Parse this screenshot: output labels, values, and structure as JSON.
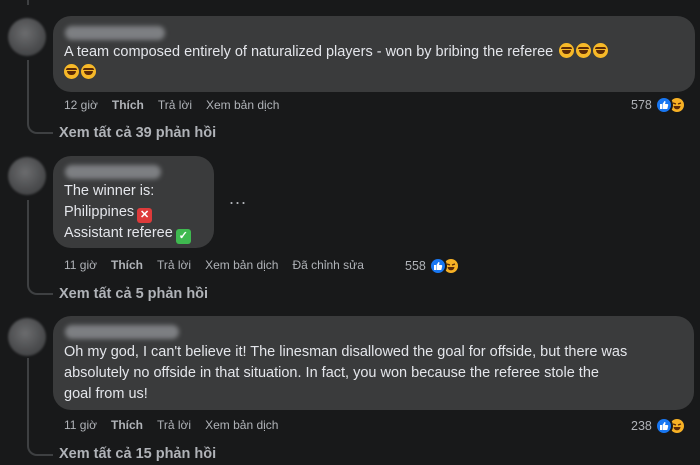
{
  "comments": [
    {
      "text_line1": "A team composed entirely of naturalized players - won by bribing the referee",
      "time": "12 giờ",
      "like_label": "Thích",
      "reply_label": "Trả lời",
      "translate_label": "Xem bản dịch",
      "reaction_count": "578",
      "view_replies": "Xem tất cả 39 phản hồi"
    },
    {
      "text_line1": "The winner is:",
      "text_line2": "Philippines",
      "text_line3": "Assistant referee",
      "time": "11 giờ",
      "like_label": "Thích",
      "reply_label": "Trả lời",
      "translate_label": "Xem bản dịch",
      "edited_label": "Đã chỉnh sửa",
      "reaction_count": "558",
      "view_replies": "Xem tất cả 5 phản hồi",
      "more_options": "..."
    },
    {
      "text_line1": "Oh my god, I can't believe it! The linesman disallowed the goal for offside, but there was",
      "text_line2": "absolutely no offside in that situation. In fact, you won because the referee stole the",
      "text_line3": "goal from us!",
      "time": "11 giờ",
      "like_label": "Thích",
      "reply_label": "Trả lời",
      "translate_label": "Xem bản dịch",
      "reaction_count": "238",
      "view_replies": "Xem tất cả 15 phản hồi"
    }
  ],
  "icons": {
    "like": "like-reaction-icon",
    "haha": "haha-reaction-icon",
    "laugh_emoji": "rolling-laughing-emoji",
    "cross": "cross-mark-emoji",
    "check": "check-mark-emoji"
  },
  "colors": {
    "background": "#18191a",
    "bubble": "#3a3b3c",
    "text": "#e4e6eb",
    "muted": "#b0b3b8",
    "like_blue": "#1877f2",
    "haha_yellow": "#f7b125"
  }
}
